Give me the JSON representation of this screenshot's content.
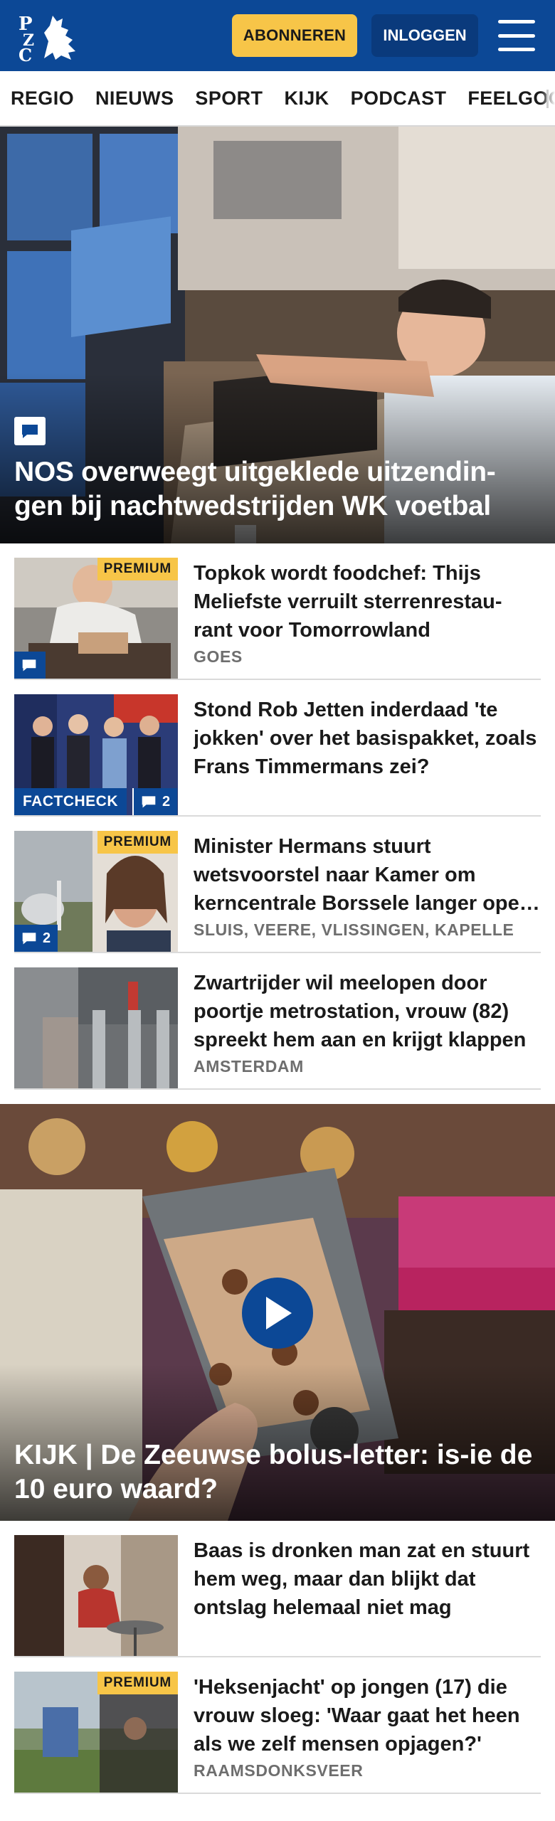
{
  "header": {
    "logo_text": "PZC",
    "subscribe_label": "ABONNEREN",
    "login_label": "INLOGGEN",
    "menu_icon": "hamburger-menu-icon"
  },
  "nav": {
    "items": [
      "REGIO",
      "NIEUWS",
      "SPORT",
      "KIJK",
      "PODCAST",
      "FEELGOOD"
    ]
  },
  "hero": {
    "title": "NOS overweegt uitgeklede uitzendin-gen bij nachtwedstrijden WK voetbal",
    "comment_icon": "comment-icon"
  },
  "articles": [
    {
      "title": "Topkok wordt foodchef: Thijs Meliefste verruilt sterrenrestau-rant voor Tomorrowland",
      "meta": "GOES",
      "premium_label": "PREMIUM",
      "comment_icon": "comment-icon"
    },
    {
      "title": "Stond Rob Jetten inderdaad 'te jokken' over het basispakket, zoals Frans Timmermans zei?",
      "meta": "",
      "factcheck_label": "FACTCHECK",
      "comment_count": "2"
    },
    {
      "title": "Minister Hermans stuurt wetsvoorstel naar Kamer om kerncentrale Borssele langer open te houden",
      "meta": "SLUIS, VEERE, VLISSINGEN, KAPELLE",
      "premium_label": "PREMIUM",
      "comment_count": "2"
    },
    {
      "title": "Zwartrijder wil meelopen door poortje metrostation, vrouw (82) spreekt hem aan en krijgt klappen",
      "meta": "AMSTERDAM"
    }
  ],
  "video": {
    "title": "KIJK | De Zeeuwse bolus-letter: is-ie de 10 euro waard?",
    "play_icon": "play-icon"
  },
  "articles2": [
    {
      "title": "Baas is dronken man zat en stuurt hem weg, maar dan blijkt dat ontslag helemaal niet mag",
      "meta": ""
    },
    {
      "title": "'Heksenjacht' op jongen (17) die vrouw sloeg: 'Waar gaat het heen als we zelf mensen opjagen?'",
      "meta": "RAAMSDONKSVEER",
      "premium_label": "PREMIUM"
    }
  ],
  "colors": {
    "brand_blue": "#0c4896",
    "accent_yellow": "#f7c548"
  }
}
